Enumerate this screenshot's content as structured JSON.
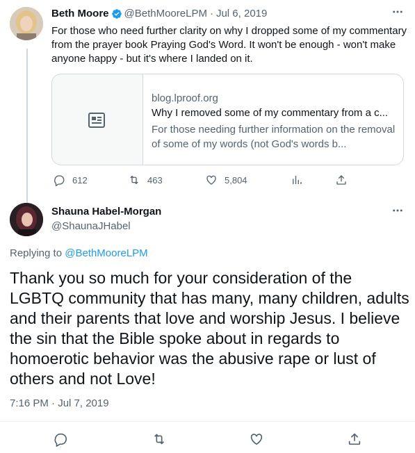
{
  "tweet1": {
    "name": "Beth Moore",
    "handle": "@BethMooreLPM",
    "separator": "·",
    "date": "Jul 6, 2019",
    "text": "For those who need further clarity on why I dropped some of my commentary from the prayer book Praying God's Word. It won't be enough - won't make anyone happy - but it's where I landed on it.",
    "card": {
      "domain": "blog.lproof.org",
      "title": "Why I removed some of my commentary from a c...",
      "description": "For those needing further information on the removal of some of my words (not God's words b..."
    },
    "actions": {
      "replies": "612",
      "retweets": "463",
      "likes": "5,804"
    }
  },
  "tweet2": {
    "name": "Shauna Habel-Morgan",
    "handle": "@ShaunaJHabel",
    "replying_prefix": "Replying to",
    "replying_handle": "@BethMooreLPM",
    "text": "Thank you so much for your consideration of the LGBTQ community that has many, many children, adults and their parents that love and worship Jesus. I believe the sin that the Bible spoke about in regards to homoerotic behavior was the abusive rape or lust of others and not Love!",
    "timestamp": "7:16 PM · Jul 7, 2019"
  },
  "colors": {
    "accent": "#1d9bf0",
    "muted": "#536471",
    "text": "#0f1419",
    "border": "#cfd9de"
  },
  "icons": [
    "verified-badge-icon",
    "more-icon",
    "article-icon",
    "reply-icon",
    "retweet-icon",
    "like-icon",
    "views-icon",
    "share-icon"
  ]
}
